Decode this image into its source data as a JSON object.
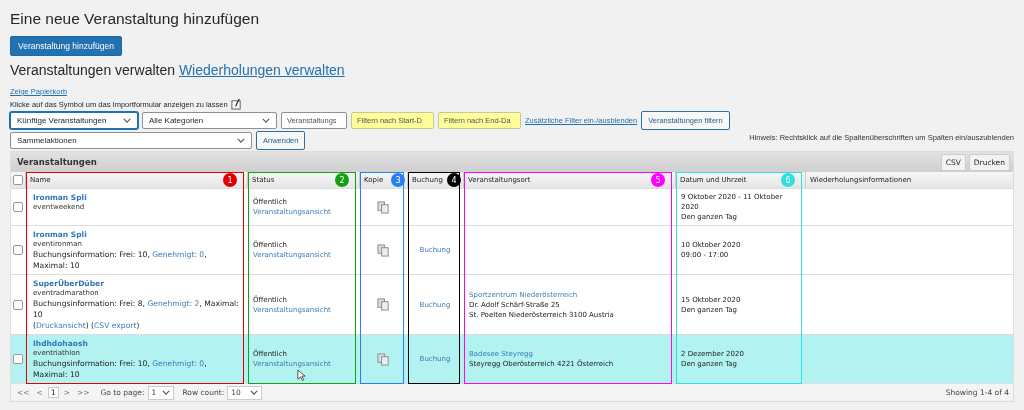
{
  "page_title": "Eine neue Veranstaltung hinzufügen",
  "add_button": "Veranstaltung hinzufügen",
  "manage_heading": "Veranstaltungen verwalten",
  "recurrences_link": "Wiederholungen verwalten",
  "trash_link": "Zeige Papierkorb",
  "import_hint": "Klicke auf das Symbol um das Importformular anzeigen zu lassen",
  "filters": [
    {
      "kind": "select",
      "value": "Künftige Veranstaltungen",
      "focused": true
    },
    {
      "kind": "select",
      "value": "Alle Kategorien",
      "focused": false
    },
    {
      "kind": "search",
      "placeholder": "Veranstaltungs"
    },
    {
      "kind": "date",
      "placeholder": "Filtern nach Start-D"
    },
    {
      "kind": "date",
      "placeholder": "Filtern nach End-Da"
    },
    {
      "kind": "link",
      "label": "Zusätzliche Filter ein-/ausblenden"
    },
    {
      "kind": "button",
      "label": "Veranstaltungen filtern"
    }
  ],
  "bulk": {
    "select": "Sammelaktionen",
    "apply": "Anwenden"
  },
  "column_hint": "Hinweis: Rechtsklick auf die Spaltenüberschriften um Spalten ein/auszublenden",
  "panel": {
    "title": "Veranstaltungen",
    "buttons": [
      "CSV",
      "Drucken"
    ]
  },
  "table": {
    "select_all": {
      "checked": false
    },
    "columns": [
      {
        "label": "Name",
        "callout": {
          "number": "1",
          "color": "#e00000"
        }
      },
      {
        "label": "Status",
        "callout": {
          "number": "2",
          "color": "#13a013"
        }
      },
      {
        "label": "Kopie",
        "callout": {
          "number": "3",
          "color": "#2b80f0"
        }
      },
      {
        "label": "Buchung",
        "callout": {
          "number": "4",
          "color": "#000000"
        }
      },
      {
        "label": "Veranstaltungsort",
        "callout": {
          "number": "5",
          "color": "#ff00ff"
        }
      },
      {
        "label": "Datum und Uhrzeit",
        "callout": {
          "number": "6",
          "color": "#33dede"
        }
      },
      {
        "label": "Wiederholungsinformationen"
      }
    ],
    "rows": [
      {
        "checked": false,
        "highlighted": false,
        "title": "Ironman Spli",
        "slug": "eventweekend",
        "status": "Öffentlich",
        "view_link": "Veranstaltungsansicht",
        "date": [
          "9 Oktober 2020 - 11 Oktober 2020",
          "Den ganzen Tag"
        ]
      },
      {
        "checked": false,
        "highlighted": false,
        "title": "Ironman Spli",
        "slug": "eventironman",
        "booking_info": [
          {
            "kind": "text",
            "text": "Buchungsinformation: Frei: 10, "
          },
          {
            "kind": "link",
            "text": "Genehmigt: 0"
          },
          {
            "kind": "text",
            "text": ", Maximal: 10"
          }
        ],
        "status": "Öffentlich",
        "view_link": "Veranstaltungsansicht",
        "booking_link": "Buchung",
        "date": [
          "10 Oktober 2020",
          "09:00 - 17:00"
        ]
      },
      {
        "checked": false,
        "highlighted": false,
        "title": "SuperÜberDüber",
        "slug": "eventradmarathon",
        "booking_info": [
          {
            "kind": "text",
            "text": "Buchungsinformation: Frei: 8, "
          },
          {
            "kind": "link",
            "text": "Genehmigt: 2"
          },
          {
            "kind": "text",
            "text": ", Maximal: 10"
          }
        ],
        "exports": [
          {
            "kind": "text",
            "text": "("
          },
          {
            "kind": "link",
            "text": "Druckansicht"
          },
          {
            "kind": "text",
            "text": ") ("
          },
          {
            "kind": "link",
            "text": "CSV export"
          },
          {
            "kind": "text",
            "text": ")"
          }
        ],
        "status": "Öffentlich",
        "view_link": "Veranstaltungsansicht",
        "booking_link": "Buchung",
        "location": {
          "link": "Sportzentrum Niederösterreich",
          "lines": [
            "Dr. Adolf Schärf-Straße 25",
            "St. Poelten Niederösterreich 3100 Austria"
          ]
        },
        "date": [
          "15 Oktober 2020",
          "Den ganzen Tag"
        ]
      },
      {
        "checked": false,
        "highlighted": true,
        "title": "Ihdhdohaosh",
        "slug": "eventriathlon",
        "booking_info": [
          {
            "kind": "text",
            "text": "Buchungsinformation: Frei: 10, "
          },
          {
            "kind": "link",
            "text": "Genehmigt: 0"
          },
          {
            "kind": "text",
            "text": ", Maximal: 10"
          }
        ],
        "status": "Öffentlich",
        "view_link": "Veranstaltungsansicht",
        "booking_link": "Buchung",
        "location": {
          "link": "Badesee Steyregg",
          "lines": [
            "Steyregg Oberösterreich 4221 Österreich"
          ]
        },
        "date": [
          "2 Dezember 2020",
          "Den ganzen Tag"
        ]
      }
    ]
  },
  "pager": {
    "nav": [
      {
        "label": "<<",
        "selected": false
      },
      {
        "label": "<",
        "selected": false
      },
      {
        "label": "1",
        "selected": true
      },
      {
        "label": ">",
        "selected": false
      },
      {
        "label": ">>",
        "selected": false
      }
    ],
    "go_to_label": "Go to page:",
    "go_to_value": "1",
    "row_count_label": "Row count:",
    "row_count_value": "10",
    "summary": "Showing 1-4 of 4"
  }
}
